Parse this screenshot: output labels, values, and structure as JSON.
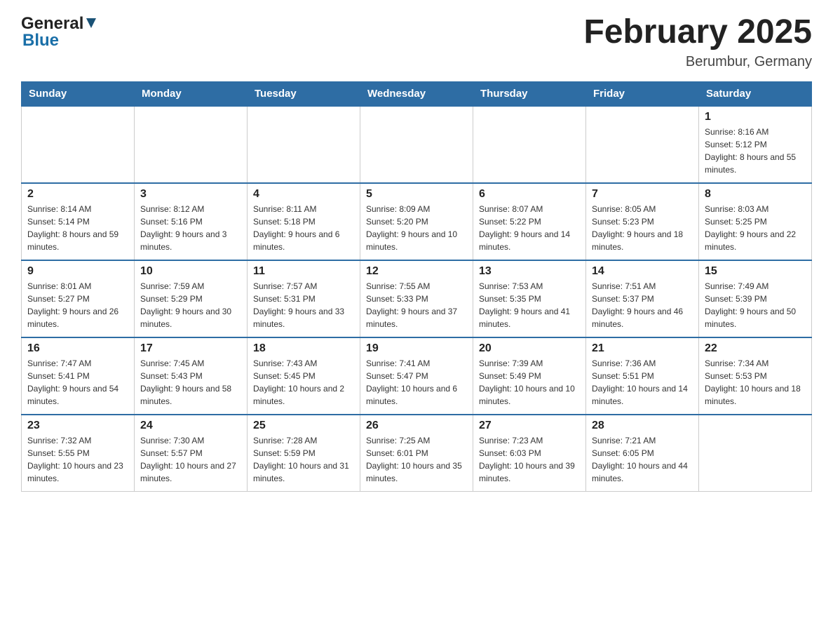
{
  "header": {
    "month_title": "February 2025",
    "location": "Berumbur, Germany",
    "logo_general": "General",
    "logo_blue": "Blue"
  },
  "days_of_week": [
    "Sunday",
    "Monday",
    "Tuesday",
    "Wednesday",
    "Thursday",
    "Friday",
    "Saturday"
  ],
  "weeks": [
    [
      {
        "day": "",
        "info": ""
      },
      {
        "day": "",
        "info": ""
      },
      {
        "day": "",
        "info": ""
      },
      {
        "day": "",
        "info": ""
      },
      {
        "day": "",
        "info": ""
      },
      {
        "day": "",
        "info": ""
      },
      {
        "day": "1",
        "info": "Sunrise: 8:16 AM\nSunset: 5:12 PM\nDaylight: 8 hours and 55 minutes."
      }
    ],
    [
      {
        "day": "2",
        "info": "Sunrise: 8:14 AM\nSunset: 5:14 PM\nDaylight: 8 hours and 59 minutes."
      },
      {
        "day": "3",
        "info": "Sunrise: 8:12 AM\nSunset: 5:16 PM\nDaylight: 9 hours and 3 minutes."
      },
      {
        "day": "4",
        "info": "Sunrise: 8:11 AM\nSunset: 5:18 PM\nDaylight: 9 hours and 6 minutes."
      },
      {
        "day": "5",
        "info": "Sunrise: 8:09 AM\nSunset: 5:20 PM\nDaylight: 9 hours and 10 minutes."
      },
      {
        "day": "6",
        "info": "Sunrise: 8:07 AM\nSunset: 5:22 PM\nDaylight: 9 hours and 14 minutes."
      },
      {
        "day": "7",
        "info": "Sunrise: 8:05 AM\nSunset: 5:23 PM\nDaylight: 9 hours and 18 minutes."
      },
      {
        "day": "8",
        "info": "Sunrise: 8:03 AM\nSunset: 5:25 PM\nDaylight: 9 hours and 22 minutes."
      }
    ],
    [
      {
        "day": "9",
        "info": "Sunrise: 8:01 AM\nSunset: 5:27 PM\nDaylight: 9 hours and 26 minutes."
      },
      {
        "day": "10",
        "info": "Sunrise: 7:59 AM\nSunset: 5:29 PM\nDaylight: 9 hours and 30 minutes."
      },
      {
        "day": "11",
        "info": "Sunrise: 7:57 AM\nSunset: 5:31 PM\nDaylight: 9 hours and 33 minutes."
      },
      {
        "day": "12",
        "info": "Sunrise: 7:55 AM\nSunset: 5:33 PM\nDaylight: 9 hours and 37 minutes."
      },
      {
        "day": "13",
        "info": "Sunrise: 7:53 AM\nSunset: 5:35 PM\nDaylight: 9 hours and 41 minutes."
      },
      {
        "day": "14",
        "info": "Sunrise: 7:51 AM\nSunset: 5:37 PM\nDaylight: 9 hours and 46 minutes."
      },
      {
        "day": "15",
        "info": "Sunrise: 7:49 AM\nSunset: 5:39 PM\nDaylight: 9 hours and 50 minutes."
      }
    ],
    [
      {
        "day": "16",
        "info": "Sunrise: 7:47 AM\nSunset: 5:41 PM\nDaylight: 9 hours and 54 minutes."
      },
      {
        "day": "17",
        "info": "Sunrise: 7:45 AM\nSunset: 5:43 PM\nDaylight: 9 hours and 58 minutes."
      },
      {
        "day": "18",
        "info": "Sunrise: 7:43 AM\nSunset: 5:45 PM\nDaylight: 10 hours and 2 minutes."
      },
      {
        "day": "19",
        "info": "Sunrise: 7:41 AM\nSunset: 5:47 PM\nDaylight: 10 hours and 6 minutes."
      },
      {
        "day": "20",
        "info": "Sunrise: 7:39 AM\nSunset: 5:49 PM\nDaylight: 10 hours and 10 minutes."
      },
      {
        "day": "21",
        "info": "Sunrise: 7:36 AM\nSunset: 5:51 PM\nDaylight: 10 hours and 14 minutes."
      },
      {
        "day": "22",
        "info": "Sunrise: 7:34 AM\nSunset: 5:53 PM\nDaylight: 10 hours and 18 minutes."
      }
    ],
    [
      {
        "day": "23",
        "info": "Sunrise: 7:32 AM\nSunset: 5:55 PM\nDaylight: 10 hours and 23 minutes."
      },
      {
        "day": "24",
        "info": "Sunrise: 7:30 AM\nSunset: 5:57 PM\nDaylight: 10 hours and 27 minutes."
      },
      {
        "day": "25",
        "info": "Sunrise: 7:28 AM\nSunset: 5:59 PM\nDaylight: 10 hours and 31 minutes."
      },
      {
        "day": "26",
        "info": "Sunrise: 7:25 AM\nSunset: 6:01 PM\nDaylight: 10 hours and 35 minutes."
      },
      {
        "day": "27",
        "info": "Sunrise: 7:23 AM\nSunset: 6:03 PM\nDaylight: 10 hours and 39 minutes."
      },
      {
        "day": "28",
        "info": "Sunrise: 7:21 AM\nSunset: 6:05 PM\nDaylight: 10 hours and 44 minutes."
      },
      {
        "day": "",
        "info": ""
      }
    ]
  ]
}
